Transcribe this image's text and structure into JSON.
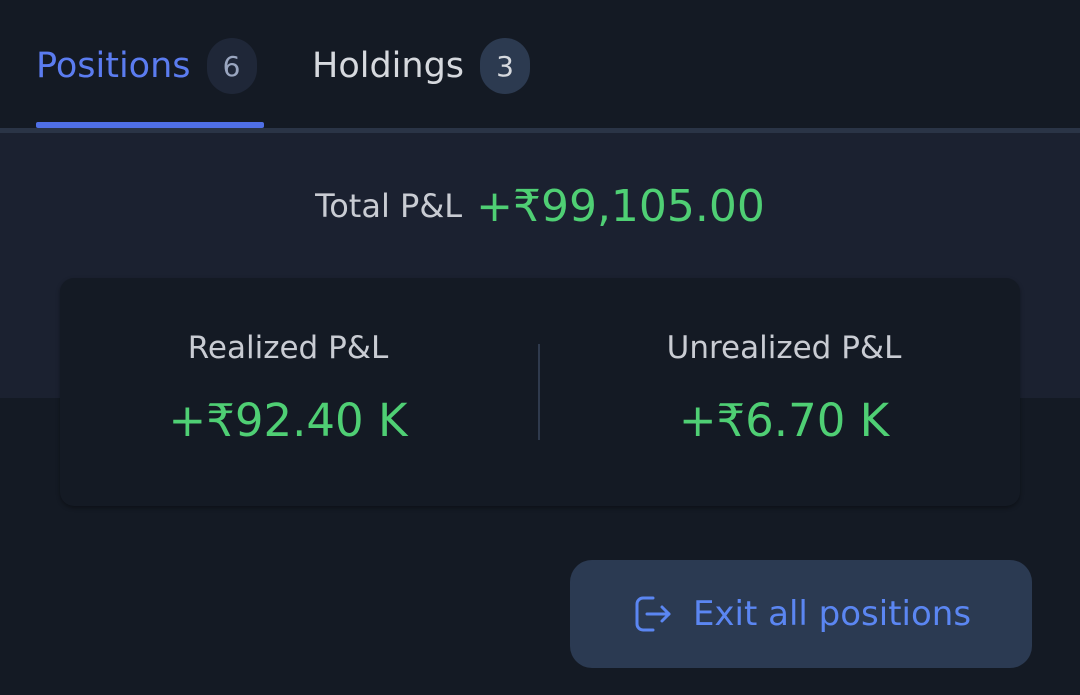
{
  "tabs": {
    "positions": {
      "label": "Positions",
      "count": "6",
      "active": true
    },
    "holdings": {
      "label": "Holdings",
      "count": "3",
      "active": false
    }
  },
  "summary": {
    "total_label": "Total P&L",
    "total_value": "+₹99,105.00",
    "realized_label": "Realized P&L",
    "realized_value": "+₹92.40 K",
    "unrealized_label": "Unrealized P&L",
    "unrealized_value": "+₹6.70 K"
  },
  "actions": {
    "exit_all_label": "Exit all positions",
    "exit_icon": "exit-icon"
  },
  "colors": {
    "accent": "#5b7cf0",
    "profit": "#4fcf74",
    "background": "#141a24",
    "band": "#1b2130",
    "button_bg": "#2b3a52"
  }
}
